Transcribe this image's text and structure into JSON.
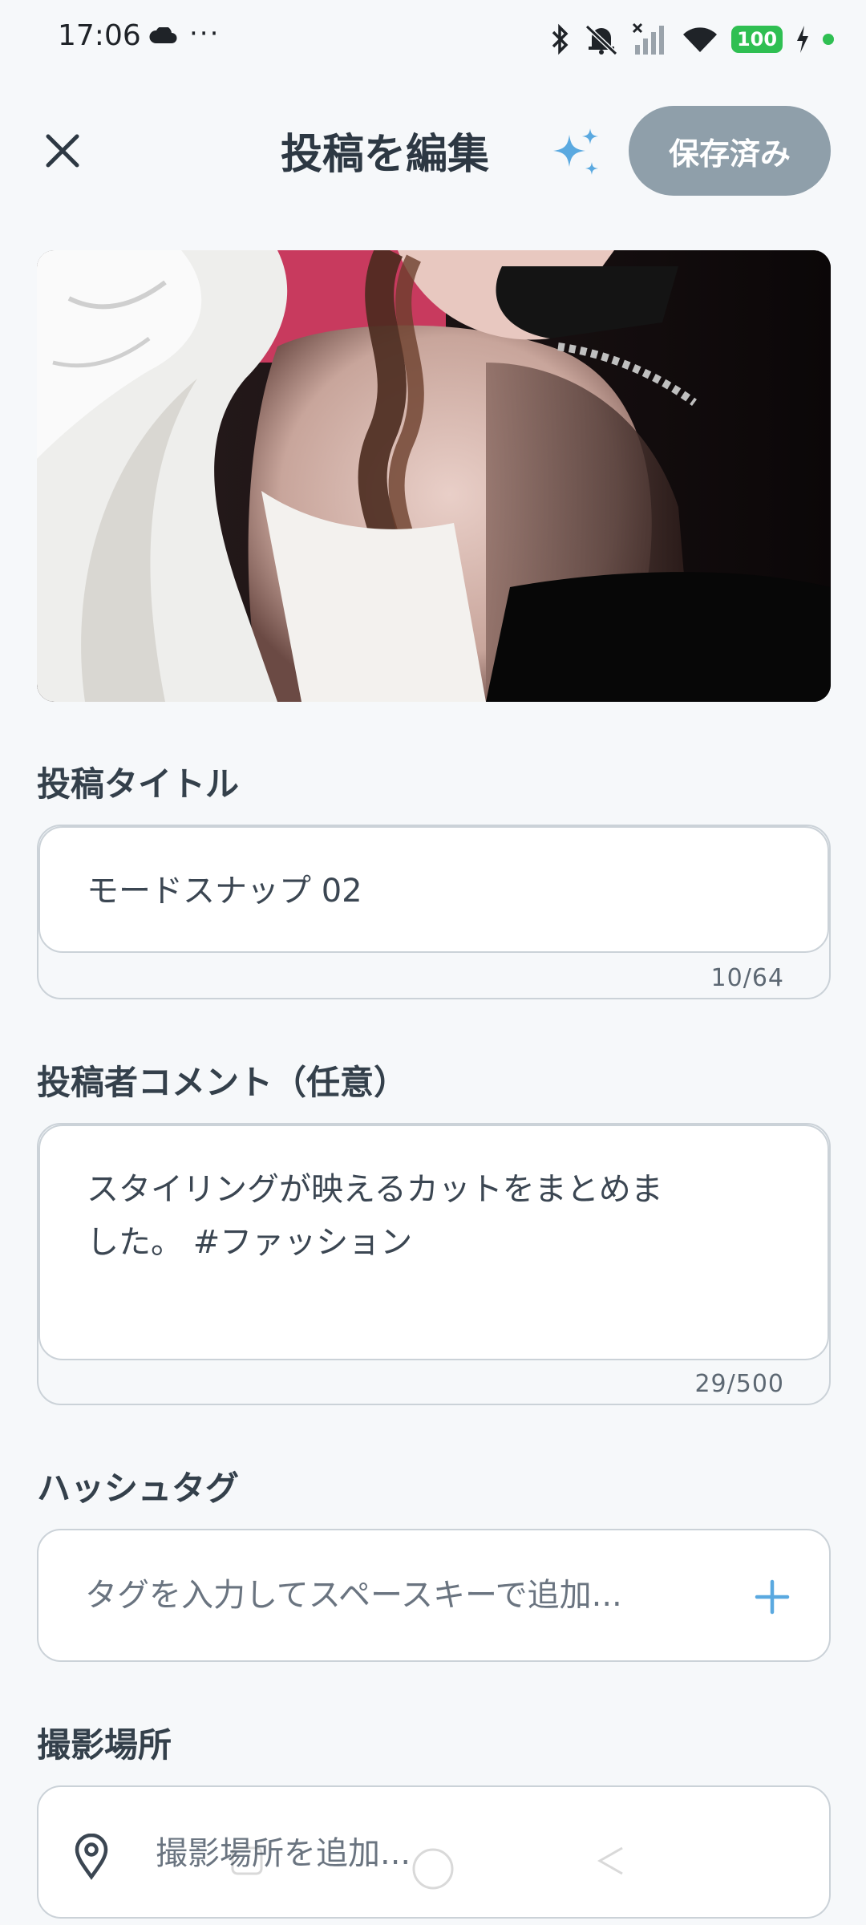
{
  "status_bar": {
    "time": "17:06",
    "more": "···",
    "battery": "100"
  },
  "header": {
    "title": "投稿を編集",
    "saved_button": "保存済み"
  },
  "title_field": {
    "label": "投稿タイトル",
    "value": "モードスナップ 02",
    "counter": "10/64"
  },
  "comment_field": {
    "label": "投稿者コメント（任意）",
    "value_line1": "スタイリングが映えるカットをまとめま",
    "value_line2": "した。 #ファッション",
    "counter": "29/500"
  },
  "hashtag_field": {
    "label": "ハッシュタグ",
    "placeholder": "タグを入力してスペースキーで追加..."
  },
  "location_field": {
    "label": "撮影場所",
    "placeholder": "撮影場所を追加..."
  },
  "colors": {
    "background": "#f6f8fa",
    "saved_button": "#8f9faa",
    "accent_blue": "#5aa9e0",
    "battery_green": "#2fbf52"
  }
}
